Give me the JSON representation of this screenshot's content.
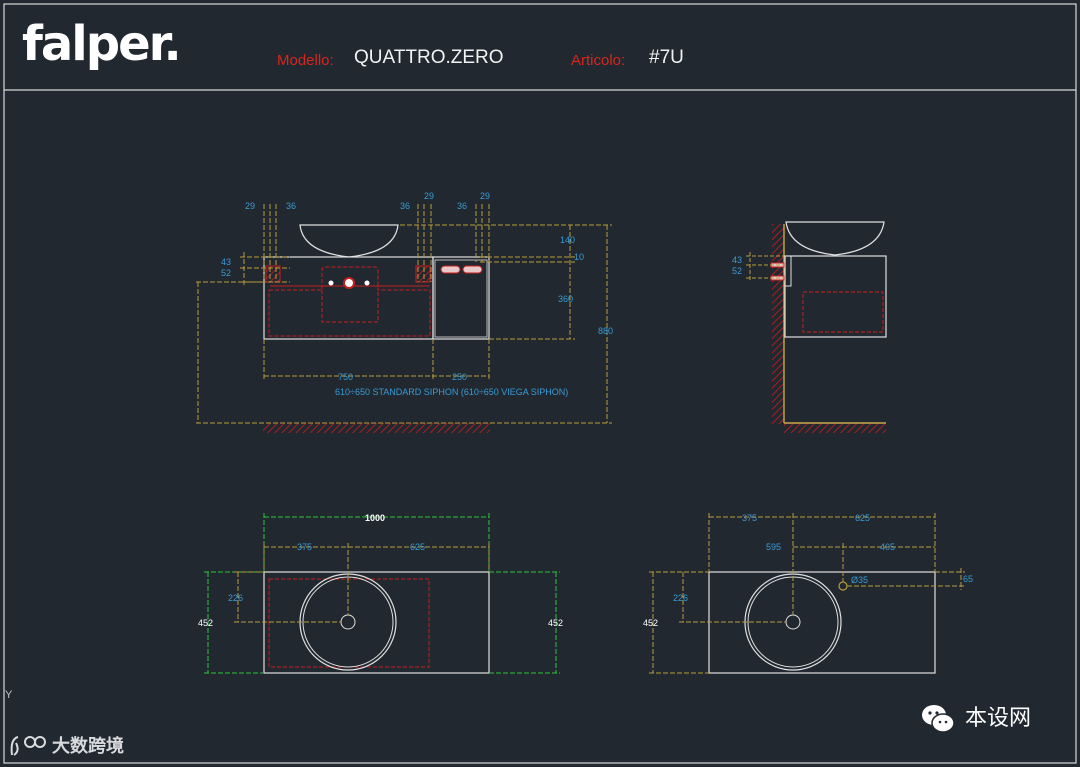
{
  "header": {
    "logo": "falper.",
    "model_label": "Modello:",
    "model_value": "QUATTRO.ZERO",
    "article_label": "Articolo:",
    "article_value": "#7U"
  },
  "front_view": {
    "dim_29_left": "29",
    "dim_36_left": "36",
    "dim_36_mid": "36",
    "dim_29_mid": "29",
    "dim_36_right": "36",
    "dim_29_right": "29",
    "dim_43": "43",
    "dim_52": "52",
    "dim_140": "140",
    "dim_10": "10",
    "dim_360": "360",
    "dim_880": "880",
    "dim_750": "750",
    "dim_250": "250",
    "siphon_note": "610÷650 STANDARD SIPHON (610÷650 VIEGA SIPHON)"
  },
  "side_view": {
    "dim_43": "43",
    "dim_52": "52"
  },
  "plan_left": {
    "dim_1000": "1000",
    "dim_375": "375",
    "dim_625": "625",
    "dim_226": "226",
    "dim_452_left": "452",
    "dim_452_right": "452"
  },
  "plan_right": {
    "dim_375": "375",
    "dim_625": "625",
    "dim_595": "595",
    "dim_405": "405",
    "dim_226": "226",
    "dim_452": "452",
    "dim_diameter": "Ø35",
    "dim_65": "65"
  },
  "ucs_label": "Y",
  "watermark": "本设网",
  "watermark2": "大数跨境",
  "colors": {
    "background": "#212830",
    "frame": "#d8d8d8",
    "dimension_yellow": "#b89b3c",
    "dimension_text_blue": "#3a9bd4",
    "dimension_green": "#2ec53a",
    "hidden_red": "#c81e1e",
    "accent_red": "#d9261c"
  }
}
